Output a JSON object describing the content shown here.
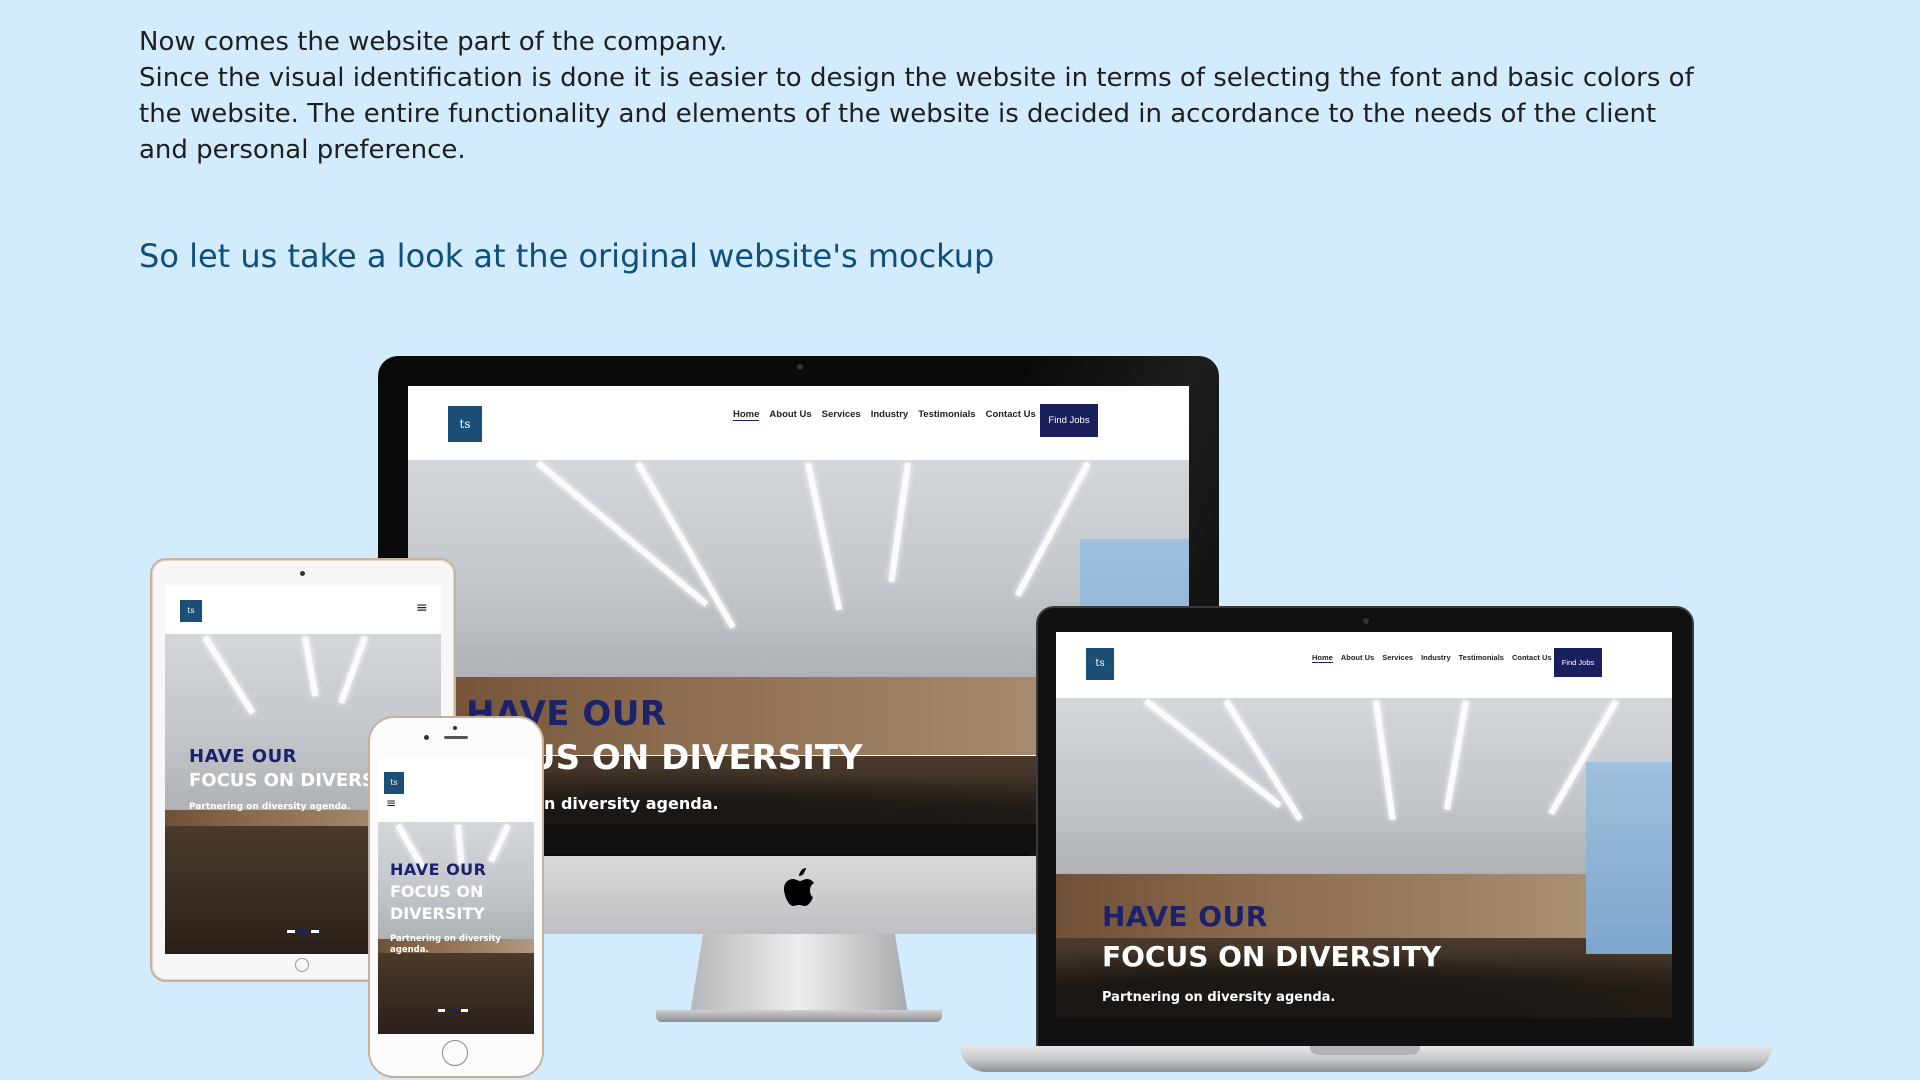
{
  "intro": {
    "line1": "Now comes the website part of the company.",
    "line2": "Since the visual identification is done it is easier to design the website in terms of selecting the font and basic colors of the website. The entire functionality and elements of the website is decided in accordance to the needs of the client and personal preference."
  },
  "heading": "So let us take a look at the original website's mockup",
  "site": {
    "logo_text": "ts",
    "nav": [
      "Home",
      "About Us",
      "Services",
      "Industry",
      "Testimonials",
      "Contact Us"
    ],
    "cta": "Find Jobs",
    "hero_line1": "HAVE OUR",
    "hero_line2": "FOCUS ON DIVERSITY",
    "hero_line2_ipad": "FOCUS ON DIVERS",
    "hero_line2_imac": "US ON DIVERSITY",
    "hero_line2_phone_a": "FOCUS ON",
    "hero_line2_phone_b": "DIVERSITY",
    "hero_sub": "Partnering on diversity agenda.",
    "hero_sub_imac": "g on diversity agenda.",
    "hero_sub_phone_a": "Partnering on diversity",
    "hero_sub_phone_b": "agenda.",
    "menu_glyph": "≡"
  },
  "colors": {
    "background": "#d2ebfd",
    "heading": "#0f4f7d",
    "brand_navy": "#1a1f5e",
    "logo_blue": "#1c4f78"
  },
  "icons": [
    "apple-icon",
    "hamburger-menu-icon"
  ]
}
